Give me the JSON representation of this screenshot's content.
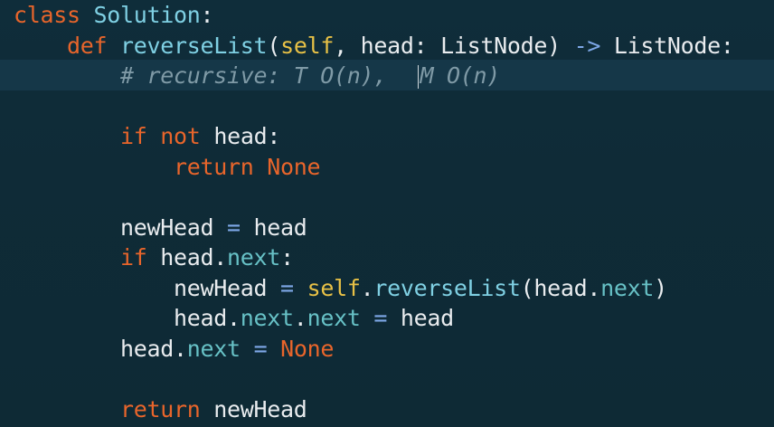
{
  "lines": [
    {
      "indent": "",
      "tokens": [
        {
          "t": "class",
          "c": "kw"
        },
        {
          "t": " ",
          "c": "plain"
        },
        {
          "t": "Solution",
          "c": "name"
        },
        {
          "t": ":",
          "c": "plain"
        }
      ]
    },
    {
      "indent": "    ",
      "tokens": [
        {
          "t": "def",
          "c": "kw"
        },
        {
          "t": " ",
          "c": "plain"
        },
        {
          "t": "reverseList",
          "c": "name"
        },
        {
          "t": "(",
          "c": "plain"
        },
        {
          "t": "self",
          "c": "self"
        },
        {
          "t": ", head: ListNode) ",
          "c": "plain"
        },
        {
          "t": "->",
          "c": "op"
        },
        {
          "t": " ListNode:",
          "c": "plain"
        }
      ]
    },
    {
      "indent": "        ",
      "tokens": [
        {
          "t": "# recursive: T O(n),  ",
          "c": "comment"
        },
        {
          "t": "",
          "c": "caret"
        },
        {
          "t": "M O(n)",
          "c": "comment"
        }
      ]
    },
    {
      "indent": "",
      "tokens": []
    },
    {
      "indent": "        ",
      "tokens": [
        {
          "t": "if",
          "c": "kw"
        },
        {
          "t": " ",
          "c": "plain"
        },
        {
          "t": "not",
          "c": "kw"
        },
        {
          "t": " head:",
          "c": "plain"
        }
      ]
    },
    {
      "indent": "            ",
      "tokens": [
        {
          "t": "return",
          "c": "kw"
        },
        {
          "t": " ",
          "c": "plain"
        },
        {
          "t": "None",
          "c": "kw"
        }
      ]
    },
    {
      "indent": "",
      "tokens": []
    },
    {
      "indent": "        ",
      "tokens": [
        {
          "t": "newHead ",
          "c": "plain"
        },
        {
          "t": "=",
          "c": "op"
        },
        {
          "t": " head",
          "c": "plain"
        }
      ]
    },
    {
      "indent": "        ",
      "tokens": [
        {
          "t": "if",
          "c": "kw"
        },
        {
          "t": " head.",
          "c": "plain"
        },
        {
          "t": "next",
          "c": "attr"
        },
        {
          "t": ":",
          "c": "plain"
        }
      ]
    },
    {
      "indent": "            ",
      "tokens": [
        {
          "t": "newHead ",
          "c": "plain"
        },
        {
          "t": "=",
          "c": "op"
        },
        {
          "t": " ",
          "c": "plain"
        },
        {
          "t": "self",
          "c": "self"
        },
        {
          "t": ".",
          "c": "plain"
        },
        {
          "t": "reverseList",
          "c": "name"
        },
        {
          "t": "(head.",
          "c": "plain"
        },
        {
          "t": "next",
          "c": "attr"
        },
        {
          "t": ")",
          "c": "plain"
        }
      ]
    },
    {
      "indent": "            ",
      "tokens": [
        {
          "t": "head.",
          "c": "plain"
        },
        {
          "t": "next",
          "c": "attr"
        },
        {
          "t": ".",
          "c": "plain"
        },
        {
          "t": "next",
          "c": "attr"
        },
        {
          "t": " ",
          "c": "plain"
        },
        {
          "t": "=",
          "c": "op"
        },
        {
          "t": " head",
          "c": "plain"
        }
      ]
    },
    {
      "indent": "        ",
      "tokens": [
        {
          "t": "head.",
          "c": "plain"
        },
        {
          "t": "next",
          "c": "attr"
        },
        {
          "t": " ",
          "c": "plain"
        },
        {
          "t": "=",
          "c": "op"
        },
        {
          "t": " ",
          "c": "plain"
        },
        {
          "t": "None",
          "c": "kw"
        }
      ]
    },
    {
      "indent": "",
      "tokens": []
    },
    {
      "indent": "        ",
      "tokens": [
        {
          "t": "return",
          "c": "kw"
        },
        {
          "t": " newHead",
          "c": "plain"
        }
      ]
    }
  ],
  "colors": {
    "background": "#0f2b37",
    "keyword": "#e8652b",
    "name": "#7fd0e3",
    "self": "#e8c146",
    "plain": "#e9ecef",
    "attr": "#67c1c6",
    "operator": "#7ea8e8",
    "comment": "#7f9aa6"
  }
}
